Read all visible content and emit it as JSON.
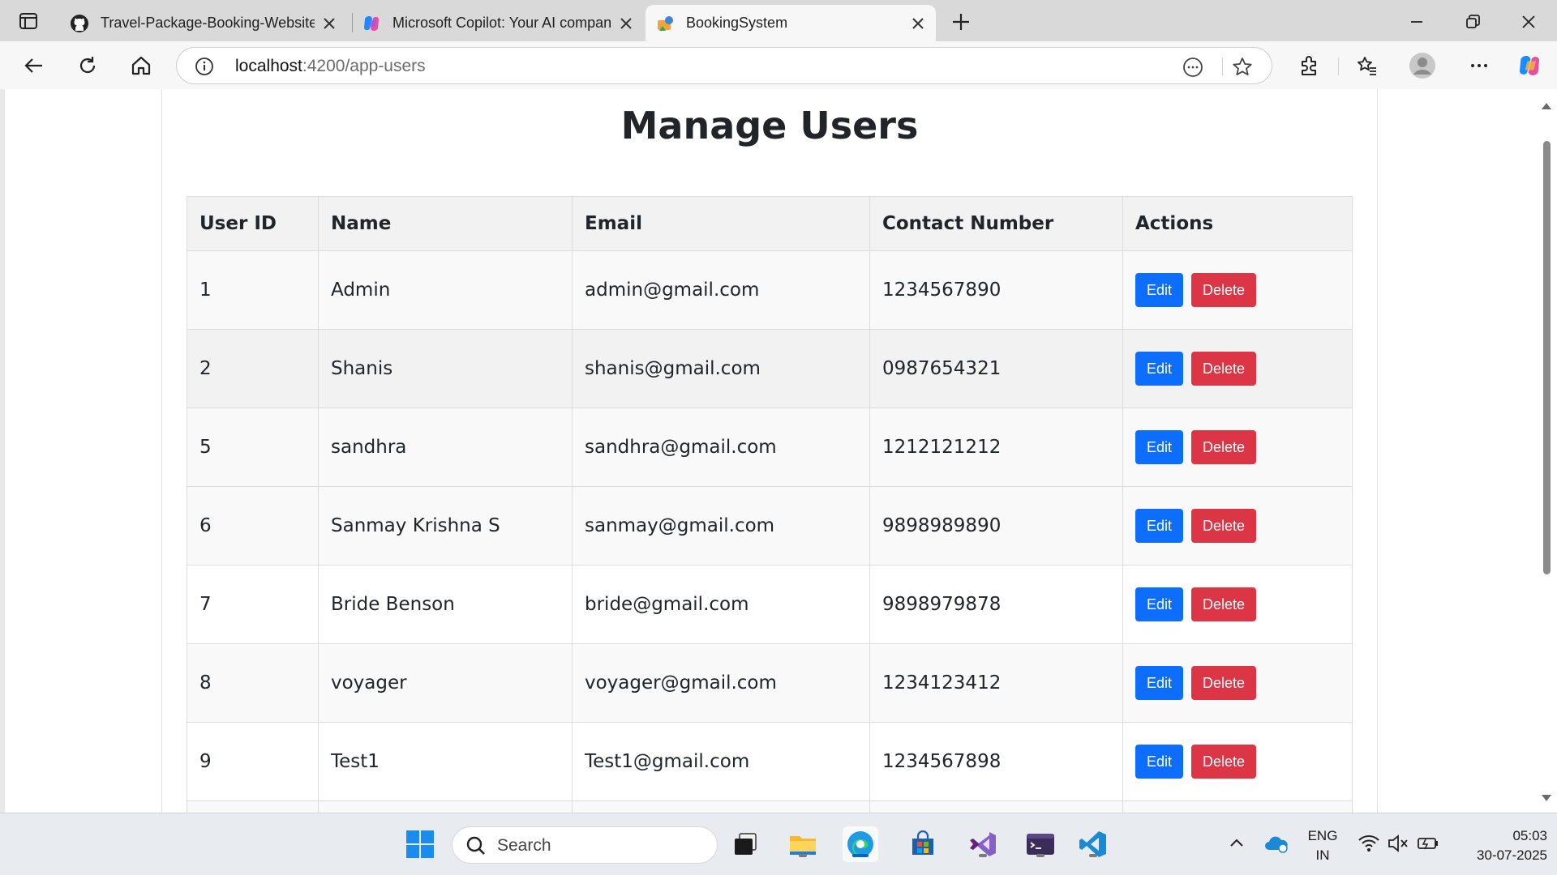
{
  "browser": {
    "tabs": [
      {
        "title": "Travel-Package-Booking-Website",
        "icon": "github-icon"
      },
      {
        "title": "Microsoft Copilot: Your AI companion",
        "icon": "copilot-icon"
      },
      {
        "title": "BookingSystem",
        "icon": "booking-icon",
        "active": true
      }
    ],
    "url_host": "localhost",
    "url_path": ":4200/app-users"
  },
  "page": {
    "title": "Manage Users",
    "columns": [
      "User ID",
      "Name",
      "Email",
      "Contact Number",
      "Actions"
    ],
    "rows": [
      {
        "id": "1",
        "name": "Admin",
        "email": "admin@gmail.com",
        "contact": "1234567890"
      },
      {
        "id": "2",
        "name": "Shanis",
        "email": "shanis@gmail.com",
        "contact": "0987654321"
      },
      {
        "id": "5",
        "name": "sandhra",
        "email": "sandhra@gmail.com",
        "contact": "1212121212"
      },
      {
        "id": "6",
        "name": "Sanmay Krishna S",
        "email": "sanmay@gmail.com",
        "contact": "9898989890"
      },
      {
        "id": "7",
        "name": "Bride Benson",
        "email": "bride@gmail.com",
        "contact": "9898979878"
      },
      {
        "id": "8",
        "name": "voyager",
        "email": "voyager@gmail.com",
        "contact": "1234123412"
      },
      {
        "id": "9",
        "name": "Test1",
        "email": "Test1@gmail.com",
        "contact": "1234567898"
      }
    ],
    "edit_label": "Edit",
    "delete_label": "Delete",
    "colors": {
      "edit": "#0d6efd",
      "delete": "#dc3545"
    }
  },
  "taskbar": {
    "search_label": "Search",
    "lang_top": "ENG",
    "lang_bottom": "IN",
    "time": "05:03",
    "date": "30-07-2025"
  }
}
